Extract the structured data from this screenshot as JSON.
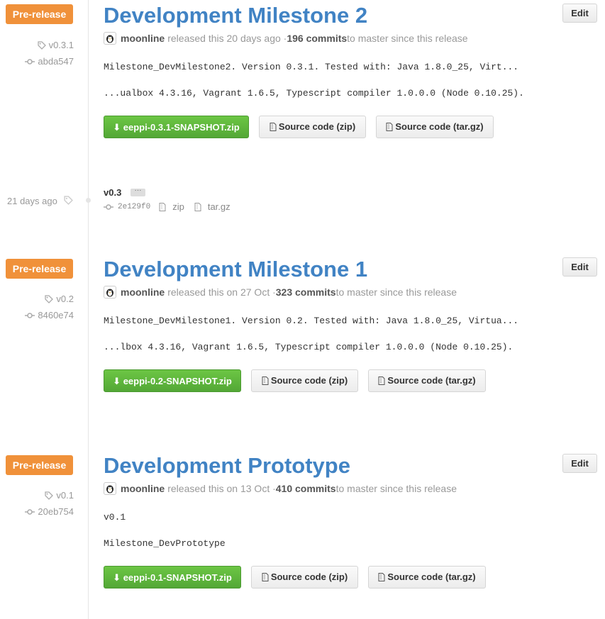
{
  "releases": [
    {
      "badge": "Pre-release",
      "tag": "v0.3.1",
      "commit": "abda547",
      "title": "Development Milestone 2",
      "edit_label": "Edit",
      "author": "moonline",
      "released_text": "released this 20 days ago · ",
      "commits_count": "196 commits",
      "commits_suffix": " to master since this release",
      "body_lines": [
        "Milestone_DevMilestone2. Version 0.3.1. Tested with: Java 1.8.0_25, Virt...",
        "...ualbox 4.3.16, Vagrant 1.6.5, Typescript compiler 1.0.0.0 (Node 0.10.25)."
      ],
      "download_label": "eeppi-0.3.1-SNAPSHOT.zip",
      "source_zip_label": "Source code (zip)",
      "source_tgz_label": "Source code (tar.gz)"
    },
    {
      "badge": "Pre-release",
      "tag": "v0.2",
      "commit": "8460e74",
      "title": "Development Milestone 1",
      "edit_label": "Edit",
      "author": "moonline",
      "released_text": "released this on 27 Oct · ",
      "commits_count": "323 commits",
      "commits_suffix": " to master since this release",
      "body_lines": [
        "Milestone_DevMilestone1. Version 0.2. Tested with: Java 1.8.0_25, Virtua...",
        "...lbox 4.3.16, Vagrant 1.6.5, Typescript compiler 1.0.0.0 (Node 0.10.25)."
      ],
      "download_label": "eeppi-0.2-SNAPSHOT.zip",
      "source_zip_label": "Source code (zip)",
      "source_tgz_label": "Source code (tar.gz)"
    },
    {
      "badge": "Pre-release",
      "tag": "v0.1",
      "commit": "20eb754",
      "title": "Development Prototype",
      "edit_label": "Edit",
      "author": "moonline",
      "released_text": "released this on 13 Oct · ",
      "commits_count": "410 commits",
      "commits_suffix": " to master since this release",
      "body_lines": [
        "v0.1",
        "Milestone_DevPrototype"
      ],
      "download_label": "eeppi-0.1-SNAPSHOT.zip",
      "source_zip_label": "Source code (zip)",
      "source_tgz_label": "Source code (tar.gz)"
    }
  ],
  "tag_only": {
    "when": "21 days ago",
    "name": "v0.3",
    "ellipsis": "···",
    "commit": "2e129f0",
    "zip_label": "zip",
    "tgz_label": "tar.gz"
  },
  "colors": {
    "prerelease": "#f0913a",
    "title_link": "#4183c4",
    "download_green": "#6cc644"
  }
}
